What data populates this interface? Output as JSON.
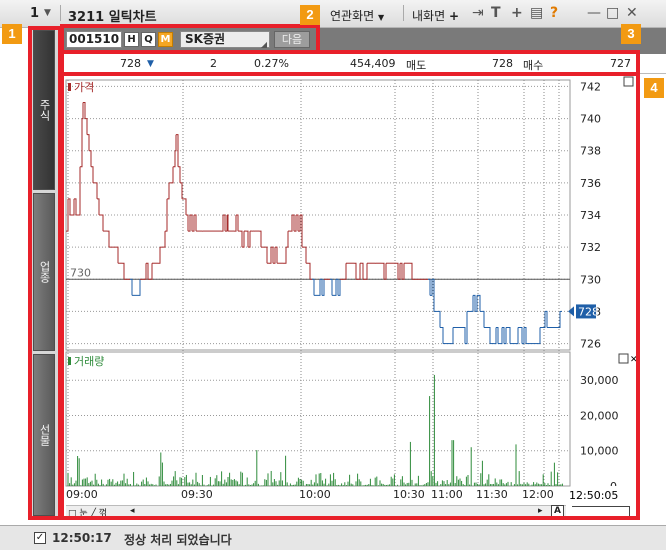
{
  "window": {
    "number": "1",
    "title": "3211 일틱차트",
    "menu": [
      "연관화면",
      "내화면"
    ]
  },
  "badges": [
    "1",
    "2",
    "3",
    "4"
  ],
  "side_tabs": [
    "주식",
    "업종",
    "선물"
  ],
  "header": {
    "code": "001510",
    "buttons": [
      "H",
      "Q",
      "M"
    ],
    "name": "SK증권",
    "next_label": "다음"
  },
  "quote": {
    "price": "728",
    "change_dir": "▼",
    "change": "2",
    "rate": "0.27%",
    "volume": "454,409",
    "ask_label": "매도",
    "ask": "728",
    "bid_label": "매수",
    "bid": "727"
  },
  "chart_data": [
    {
      "type": "line",
      "title": "가격",
      "y_ticks": [
        742,
        740,
        738,
        736,
        734,
        732,
        730,
        728,
        726
      ],
      "ylim": [
        725.6,
        742.4
      ],
      "reference": 730,
      "reference_label": "730",
      "current": 728,
      "current_label": "728",
      "up_color": "#a52a2a",
      "down_color": "#1f5fa8"
    },
    {
      "type": "bar",
      "title": "거래량",
      "y_ticks": [
        "30,000",
        "20,000",
        "10,000",
        "0"
      ],
      "y_values": [
        30000,
        20000,
        10000,
        0
      ],
      "ylim": [
        0,
        38000
      ],
      "color": "#2e8b3a"
    }
  ],
  "x_axis": {
    "ticks": [
      "09:00",
      "09:30",
      "10:00",
      "10:30",
      "11:00",
      "11:30",
      "12:00"
    ],
    "current_time": "12:50:05"
  },
  "scrollbar": {
    "left_label": "□ 눈 ╱ 꺾"
  },
  "status": {
    "checkmark": "✓",
    "time": "12:50:17",
    "message": "정상 처리 되었습니다"
  },
  "colors": {
    "accent_red": "#e8202a",
    "badge_orange": "#f29a12"
  }
}
